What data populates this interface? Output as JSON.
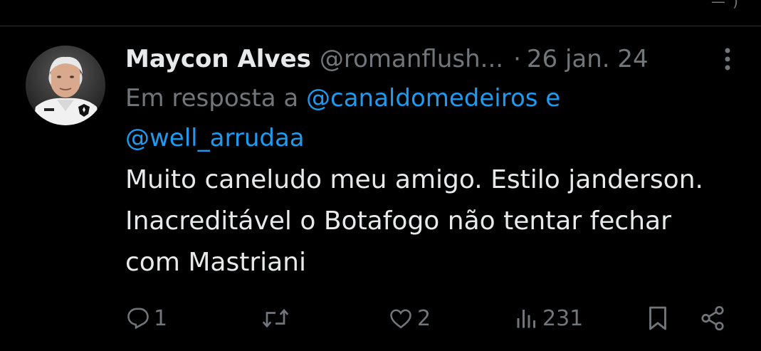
{
  "tweet": {
    "author": {
      "display_name": "Maycon Alves",
      "handle": "@romanflush...",
      "avatar_icon": "profile-photo"
    },
    "separator": "·",
    "date": "26 jan. 24",
    "reply_context": {
      "prefix": "Em resposta a",
      "mentions": [
        "@canaldomedeiros",
        "@well_arrudaa"
      ],
      "conjunction": "e"
    },
    "text_lines": [
      "Muito caneludo meu amigo. Estilo janderson.",
      "Inacreditável o Botafogo não tentar fechar",
      "com Mastriani"
    ],
    "actions": {
      "reply": {
        "icon": "reply-icon",
        "count": "1"
      },
      "retweet": {
        "icon": "retweet-icon",
        "count": ""
      },
      "like": {
        "icon": "heart-icon",
        "count": "2"
      },
      "views": {
        "icon": "views-icon",
        "count": "231"
      },
      "bookmark": {
        "icon": "bookmark-icon"
      },
      "share": {
        "icon": "share-icon"
      }
    }
  },
  "colors": {
    "background": "#000000",
    "text_primary": "#e7e9ea",
    "text_secondary": "#71767b",
    "link": "#1d9bf0",
    "divider": "#2f3336"
  }
}
